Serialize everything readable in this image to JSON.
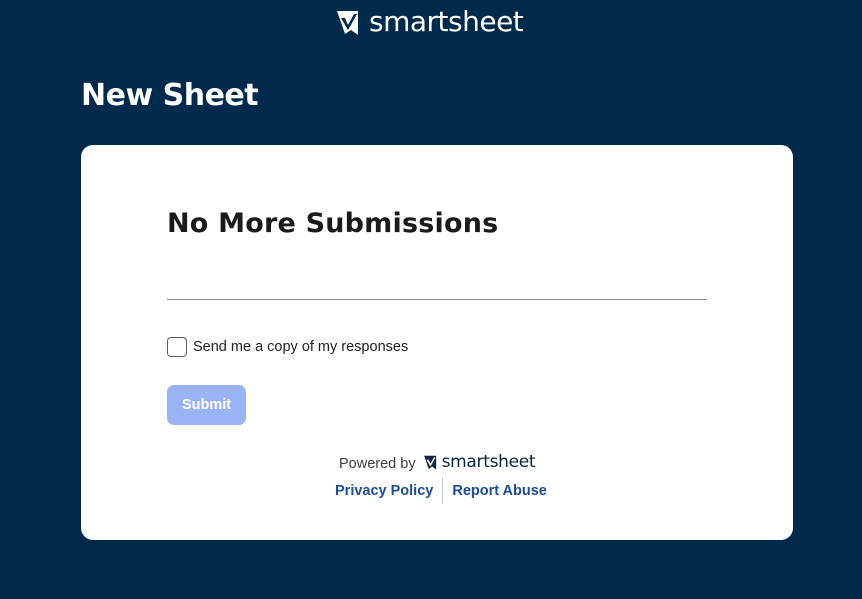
{
  "brand": {
    "name": "smartsheet"
  },
  "form": {
    "title": "New Sheet",
    "heading": "No More Submissions",
    "copy_checkbox_label": "Send me a copy of my responses",
    "copy_checkbox_checked": false,
    "submit_label": "Submit",
    "submit_enabled": false
  },
  "footer": {
    "powered_by": "Powered by",
    "brand_name": "smartsheet",
    "links": [
      {
        "label": "Privacy Policy"
      },
      {
        "label": "Report Abuse"
      }
    ]
  },
  "colors": {
    "page_background": "#002a4c",
    "card_background": "#ffffff",
    "submit_disabled": "#9ab3f5",
    "link": "#1f4a96"
  },
  "icons": [
    "smartsheet-logo-icon",
    "checkbox-icon"
  ]
}
